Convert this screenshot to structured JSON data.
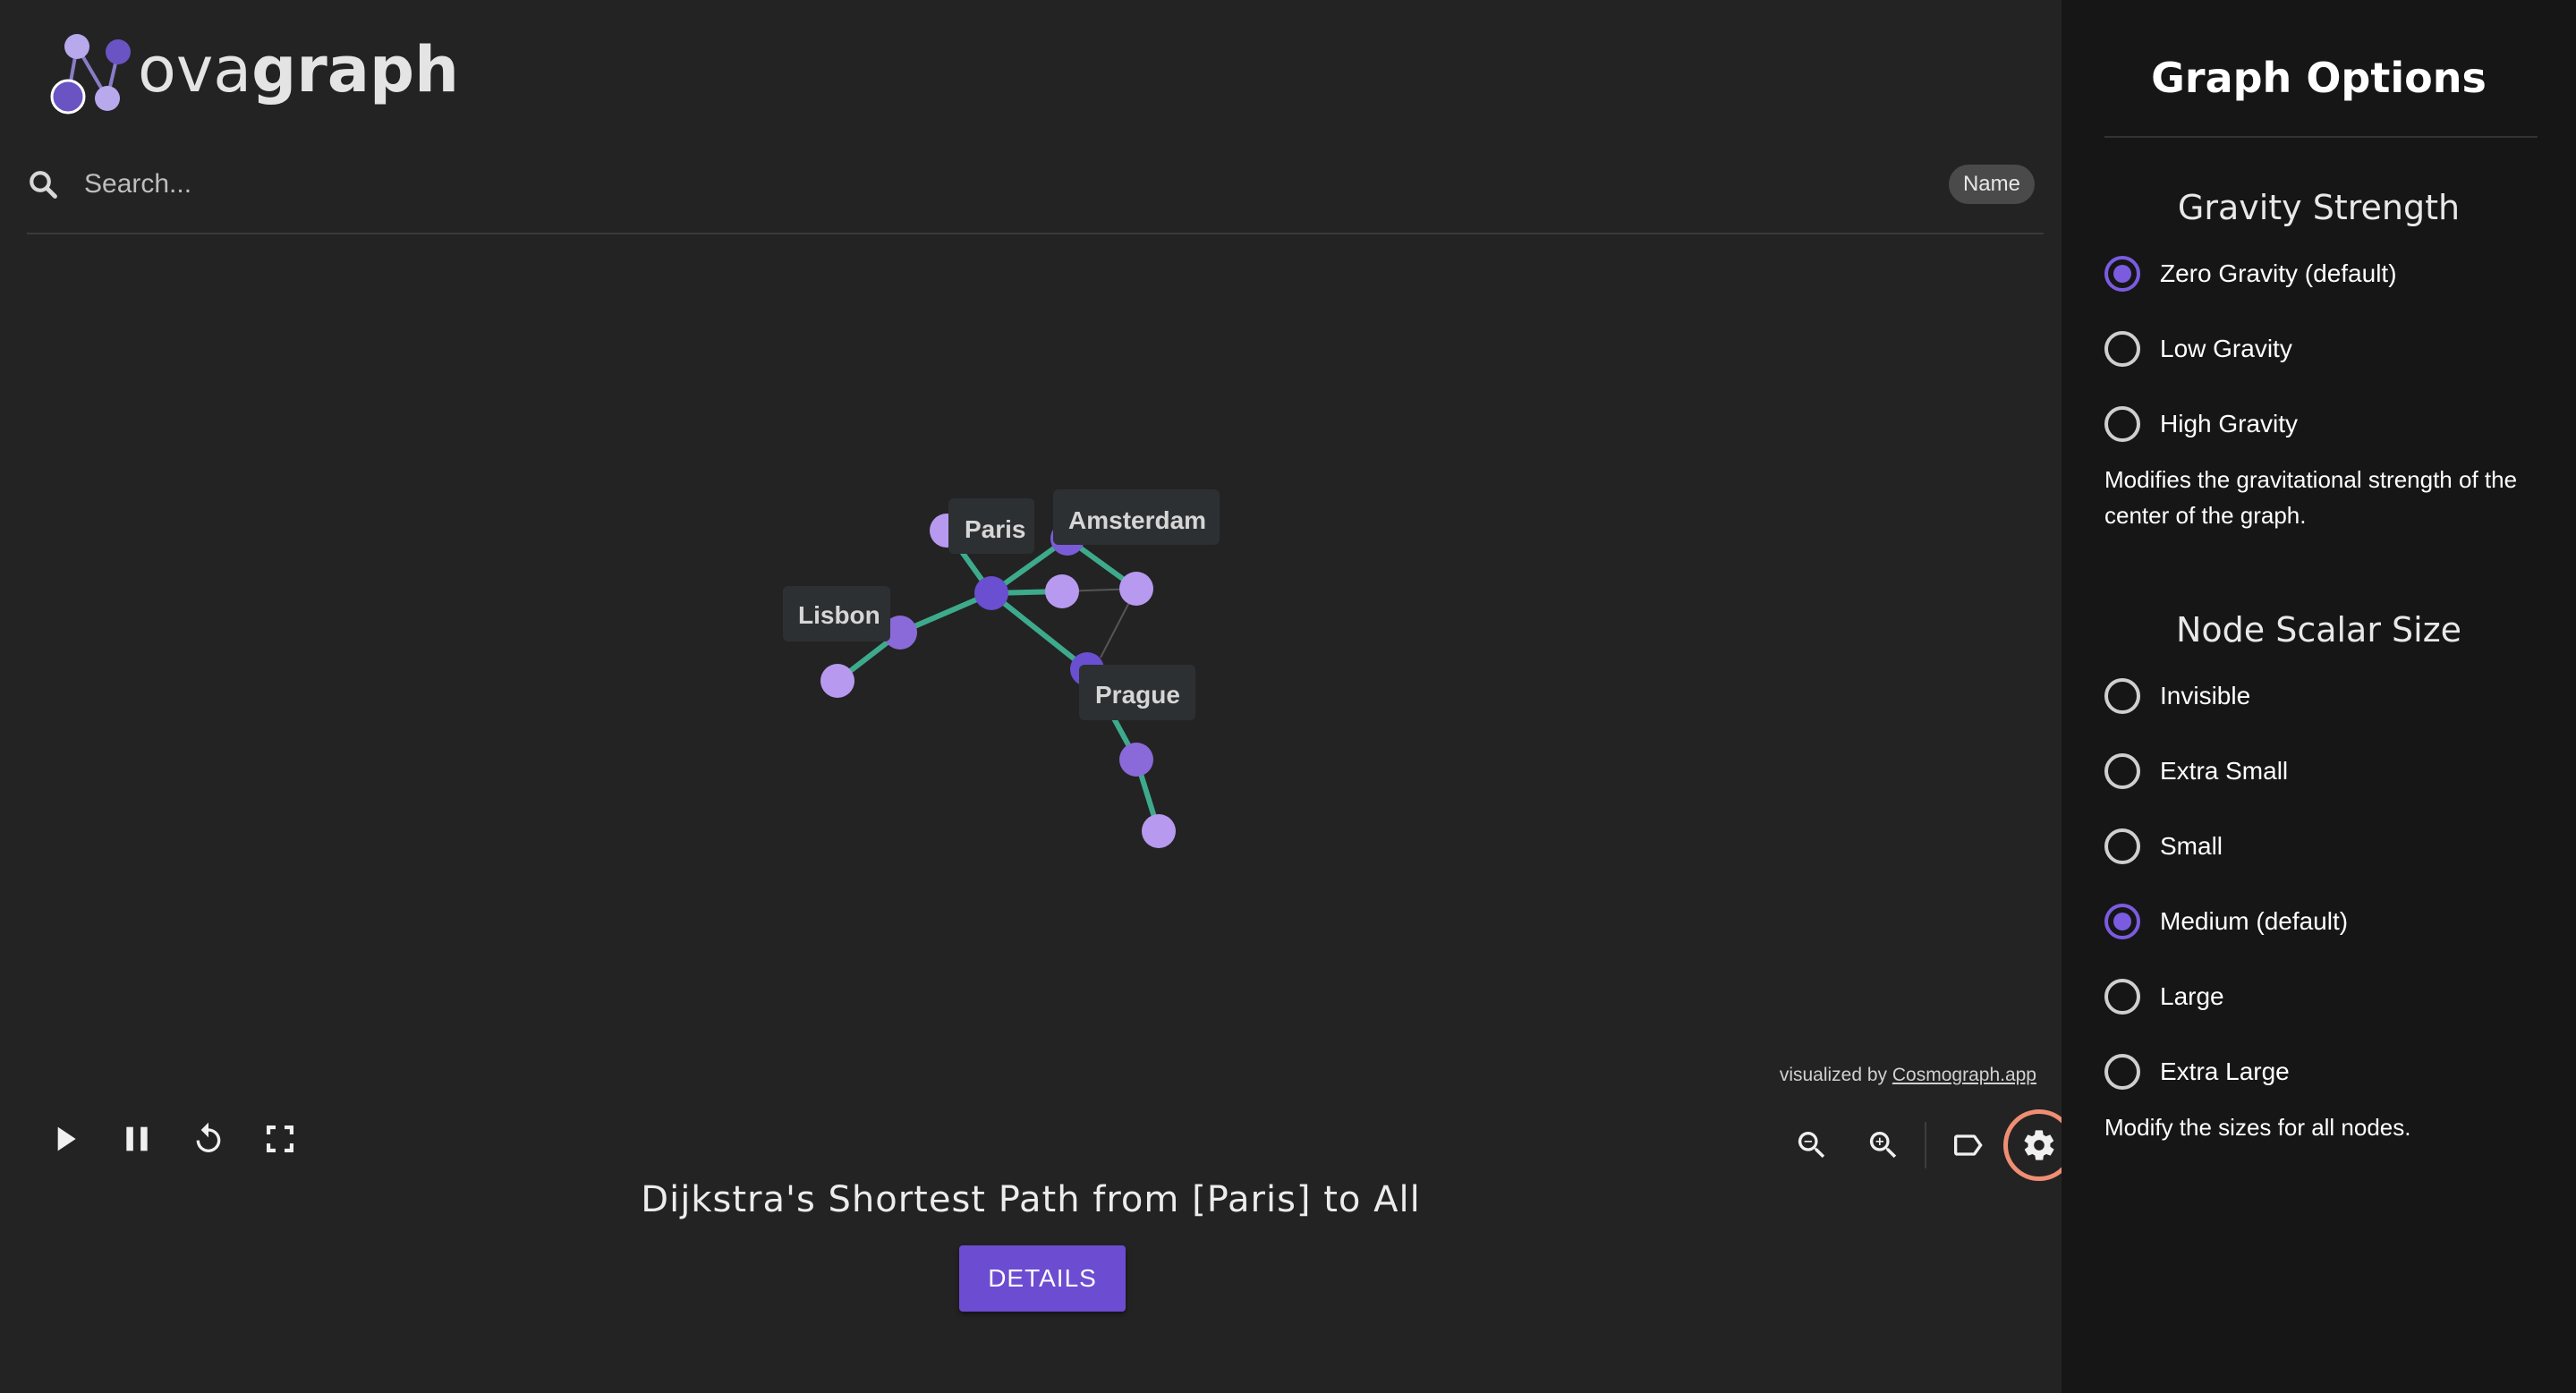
{
  "brand": {
    "name_light": "ova",
    "name_bold": "graph"
  },
  "search": {
    "placeholder": "Search...",
    "chip": "Name"
  },
  "graph": {
    "labels": [
      "Paris",
      "Amsterdam",
      "Lisbon",
      "Prague"
    ],
    "credit_prefix": "visualized by ",
    "credit_link": "Cosmograph.app",
    "colors": {
      "edge": "#3eaa8c",
      "node_light": "#b79af0",
      "node_dark": "#6a4fd0",
      "node_mid": "#8a6ad8"
    }
  },
  "controls": {
    "left": [
      "play-icon",
      "pause-icon",
      "restart-icon",
      "fullscreen-icon"
    ],
    "right": [
      "zoom-out-icon",
      "zoom-in-icon",
      "label-icon",
      "gear-icon"
    ]
  },
  "result": {
    "title": "Dijkstra's Shortest Path from [Paris] to All",
    "details_label": "DETAILS"
  },
  "sidebar": {
    "title": "Graph Options",
    "gravity": {
      "title": "Gravity Strength",
      "options": [
        "Zero Gravity (default)",
        "Low Gravity",
        "High Gravity"
      ],
      "selected": "Zero Gravity (default)",
      "description": "Modifies the gravitational strength of the center of the graph."
    },
    "node_size": {
      "title": "Node Scalar Size",
      "options": [
        "Invisible",
        "Extra Small",
        "Small",
        "Medium (default)",
        "Large",
        "Extra Large"
      ],
      "selected": "Medium (default)",
      "description": "Modify the sizes for all nodes."
    },
    "accent": "#7b5ce0"
  }
}
